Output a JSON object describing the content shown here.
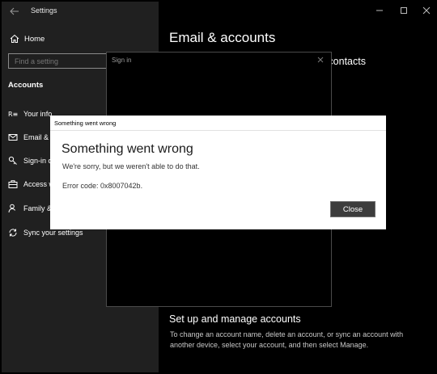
{
  "window": {
    "title": "Settings"
  },
  "sidebar": {
    "home_label": "Home",
    "search_placeholder": "Find a setting",
    "section_title": "Accounts",
    "items": [
      {
        "label": "Your info",
        "icon": "person-card-icon"
      },
      {
        "label": "Email & a",
        "icon": "mail-icon"
      },
      {
        "label": "Sign-in o",
        "icon": "key-icon"
      },
      {
        "label": "Access w",
        "icon": "briefcase-icon"
      },
      {
        "label": "Family &",
        "icon": "person-add-icon"
      },
      {
        "label": "Sync your settings",
        "icon": "sync-icon"
      }
    ]
  },
  "main": {
    "title": "Email & accounts",
    "partial_heading": "d contacts",
    "bottom_heading": "Set up and manage accounts",
    "bottom_text": "To change an account name, delete an account, or sync an account with another device, select your account, and then select Manage."
  },
  "signin_dialog": {
    "title": "Sign in"
  },
  "error_dialog": {
    "window_title": "Something went wrong",
    "heading": "Something went wrong",
    "message": "We're sorry, but we weren't able to do that.",
    "error_code": "Error code: 0x8007042b.",
    "close_label": "Close"
  }
}
